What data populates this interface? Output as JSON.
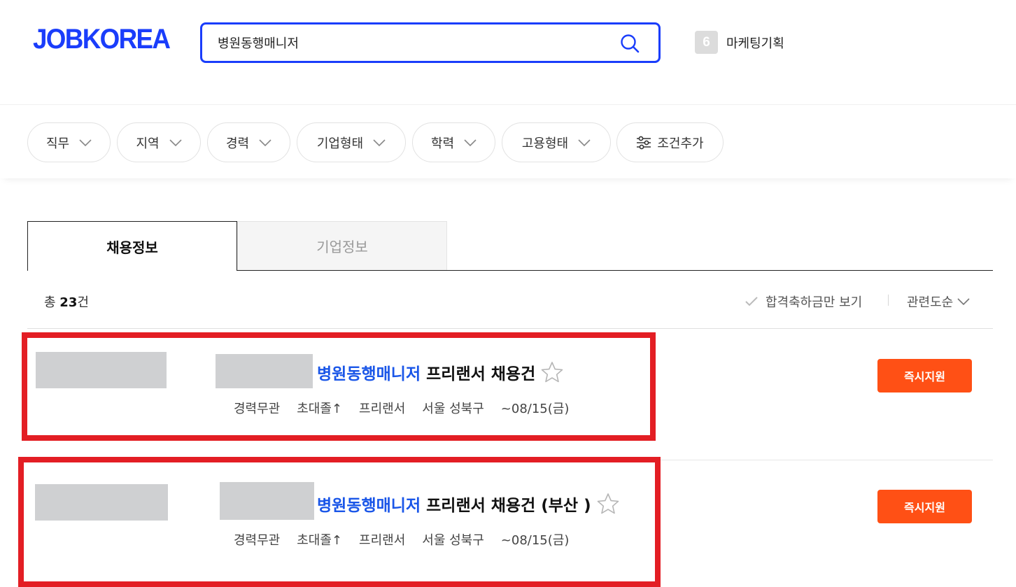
{
  "header": {
    "logo": "JOBKOREA",
    "search": {
      "value": "병원동행매니저"
    },
    "trending": {
      "rank": "6",
      "keyword": "마케팅기획"
    }
  },
  "filters": [
    {
      "label": "직무"
    },
    {
      "label": "지역"
    },
    {
      "label": "경력"
    },
    {
      "label": "기업형태"
    },
    {
      "label": "학력"
    },
    {
      "label": "고용형태"
    },
    {
      "label": "조건추가"
    }
  ],
  "tabs": [
    {
      "label": "채용정보",
      "active": true
    },
    {
      "label": "기업정보",
      "active": false
    }
  ],
  "results": {
    "total_prefix": "총 ",
    "total_count": "23",
    "total_suffix": "건",
    "pass_filter_label": "합격축하금만 보기",
    "sort_label": "관련도순"
  },
  "jobs": [
    {
      "title_keyword": "병원동행매니저",
      "title_rest": "프리랜서 채용건",
      "experience": "경력무관",
      "education": "초대졸↑",
      "employment": "프리랜서",
      "location": "서울 성북구",
      "deadline": "~08/15(금)",
      "apply_label": "즉시지원"
    },
    {
      "title_keyword": "병원동행매니저",
      "title_rest": "프리랜서 채용건 (부산 )",
      "experience": "경력무관",
      "education": "초대졸↑",
      "employment": "프리랜서",
      "location": "서울 성북구",
      "deadline": "~08/15(금)",
      "apply_label": "즉시지원"
    }
  ],
  "colors": {
    "brand": "#1a3dfb",
    "keyword": "#1a56e8",
    "apply": "#ff5015",
    "highlight_box": "#e31e24"
  }
}
